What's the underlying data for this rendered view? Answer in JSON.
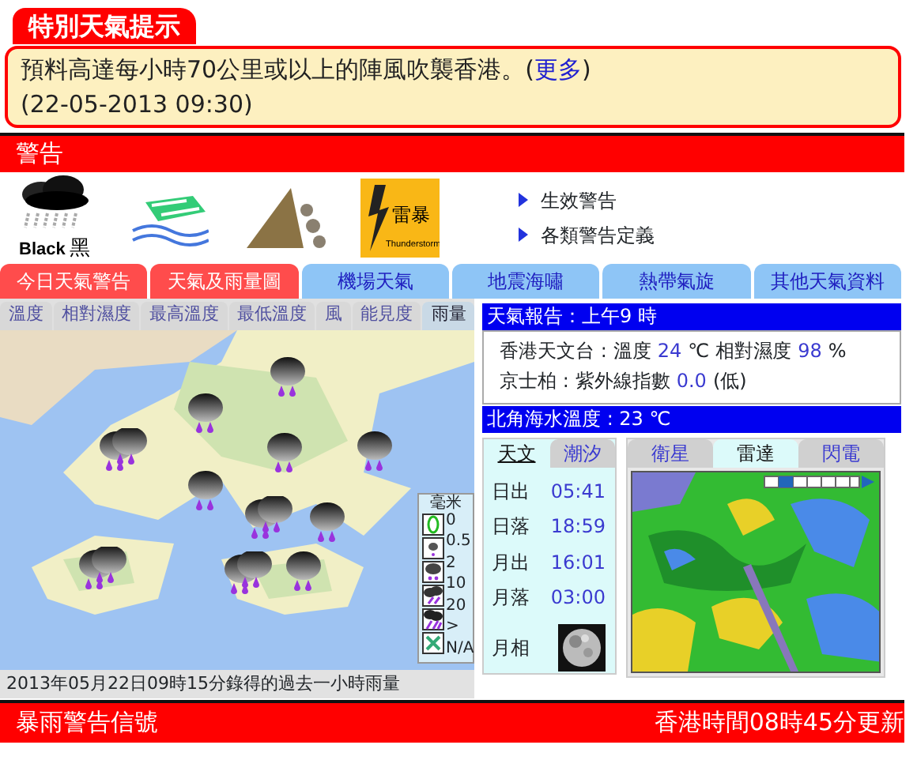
{
  "alert": {
    "tab": "特別天氣提示",
    "text_before": "預料高達每小時70公里或以上的陣風吹襲香港。(",
    "link": "更多",
    "text_after": ")",
    "time": "(22-05-2013 09:30)"
  },
  "warnings": {
    "title": "警告",
    "icons": [
      {
        "kind": "black_rain",
        "label": "Black",
        "label_zh": "黑"
      },
      {
        "kind": "monsoon"
      },
      {
        "kind": "landslip"
      },
      {
        "kind": "thunderstorm",
        "label_zh": "雷暴",
        "label": "Thunderstorm"
      }
    ],
    "links": [
      "生效警告",
      "各類警告定義"
    ]
  },
  "main_tabs": [
    {
      "label": "今日天氣警告",
      "color": "#ff4c4c"
    },
    {
      "label": "天氣及雨量圖",
      "color": "#ff4c4c"
    },
    {
      "label": "機場天氣",
      "color": "#8ec5f6"
    },
    {
      "label": "地震海嘯",
      "color": "#8ec5f6"
    },
    {
      "label": "熱帶氣旋",
      "color": "#8ec5f6"
    },
    {
      "label": "其他天氣資料",
      "color": "#8ec5f6"
    }
  ],
  "map_panel": {
    "tabs": [
      {
        "label": "溫度",
        "selected": false
      },
      {
        "label": "相對濕度",
        "selected": false
      },
      {
        "label": "最高溫度",
        "selected": false
      },
      {
        "label": "最低溫度",
        "selected": false
      },
      {
        "label": "風",
        "selected": false
      },
      {
        "label": "能見度",
        "selected": false
      },
      {
        "label": "雨量",
        "selected": true
      }
    ],
    "rain_icons": [
      {
        "kind": "single"
      },
      {
        "kind": "single"
      },
      {
        "kind": "double"
      },
      {
        "kind": "single"
      },
      {
        "kind": "single"
      },
      {
        "kind": "single"
      },
      {
        "kind": "double"
      },
      {
        "kind": "single"
      },
      {
        "kind": "double"
      },
      {
        "kind": "double"
      },
      {
        "kind": "single"
      }
    ],
    "legend": {
      "unit": "毫米",
      "labels": [
        "0",
        "0.5",
        "2",
        "10",
        "20",
        ">",
        "N/A"
      ]
    },
    "caption": "2013年05月22日09時15分錄得的過去一小時雨量"
  },
  "report": {
    "title": "天氣報告：上午9 時",
    "lines": [
      {
        "station": "香港天文台 :",
        "fields": [
          {
            "label": "溫度",
            "value": "24",
            "unit": "℃"
          },
          {
            "label": "相對濕度",
            "value": "98",
            "unit": "%"
          }
        ]
      },
      {
        "station": "京士柏 :",
        "fields": [
          {
            "label": "紫外線指數",
            "value": "0.0",
            "unit": "(低)"
          }
        ]
      }
    ],
    "sea_temp": "北角海水溫度 : 23 ℃"
  },
  "astro": {
    "tabs": [
      {
        "label": "天文",
        "selected": true
      },
      {
        "label": "潮汐",
        "selected": false
      }
    ],
    "rows": [
      {
        "label": "日出",
        "value": "05:41"
      },
      {
        "label": "日落",
        "value": "18:59"
      },
      {
        "label": "月出",
        "value": "16:01"
      },
      {
        "label": "月落",
        "value": "03:00"
      },
      {
        "label": "月相",
        "kind": "moon"
      }
    ]
  },
  "imagery": {
    "tabs": [
      {
        "label": "衛星",
        "selected": false
      },
      {
        "label": "雷達",
        "selected": true
      },
      {
        "label": "閃電",
        "selected": false
      }
    ]
  },
  "footer": {
    "left": "暴雨警告信號",
    "right": "香港時間08時45分更新"
  }
}
